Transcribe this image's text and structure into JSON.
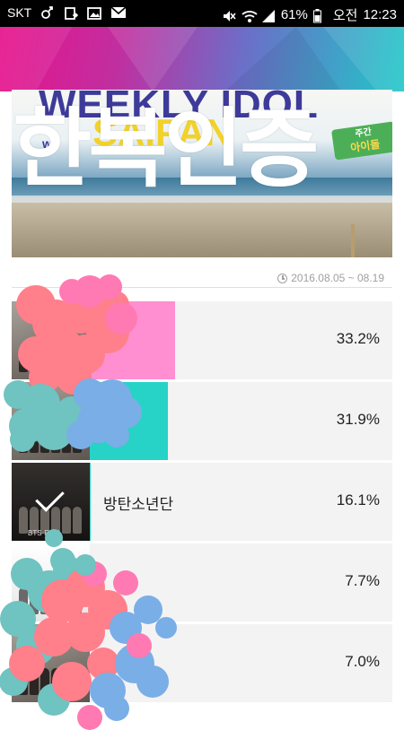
{
  "status_bar": {
    "carrier": "SKT",
    "battery": "61%",
    "ampm": "오전",
    "time": "12:23",
    "icons": [
      "female-icon",
      "nfc-icon",
      "image-icon",
      "mail-icon",
      "mute-icon",
      "wifi-icon",
      "signal-icon",
      "battery-icon"
    ]
  },
  "banner": {
    "title": "WEEKLY IDOL",
    "subtitle": "SAIPAN",
    "episode": "w",
    "sign_line1": "주간",
    "sign_line2": "아이돌",
    "overlay": "한복인증"
  },
  "date_range": "2016.08.05 ~ 08.19",
  "colors": {
    "header_start": "#e8128c",
    "header_end": "#1fc8c8",
    "bar_pink": "#ff8fd0",
    "bar_teal": "#27d3c6",
    "row_bg": "#f3f3f3"
  },
  "results": [
    {
      "name": "",
      "percent": "33.2%",
      "value": 0.332,
      "color": "#ff8fd0",
      "selected": false
    },
    {
      "name": "",
      "percent": "31.9%",
      "value": 0.319,
      "color": "#27d3c6",
      "selected": false
    },
    {
      "name": "방탄소년단",
      "percent": "16.1%",
      "value": 0.161,
      "color": "#27d3c6",
      "selected": true,
      "tag": "BTS·RUN"
    },
    {
      "name": "",
      "percent": "7.7%",
      "value": 0.077,
      "color": "#27d3c6",
      "selected": false
    },
    {
      "name": "",
      "percent": "7.0%",
      "value": 0.07,
      "color": "#27d3c6",
      "selected": false
    }
  ]
}
